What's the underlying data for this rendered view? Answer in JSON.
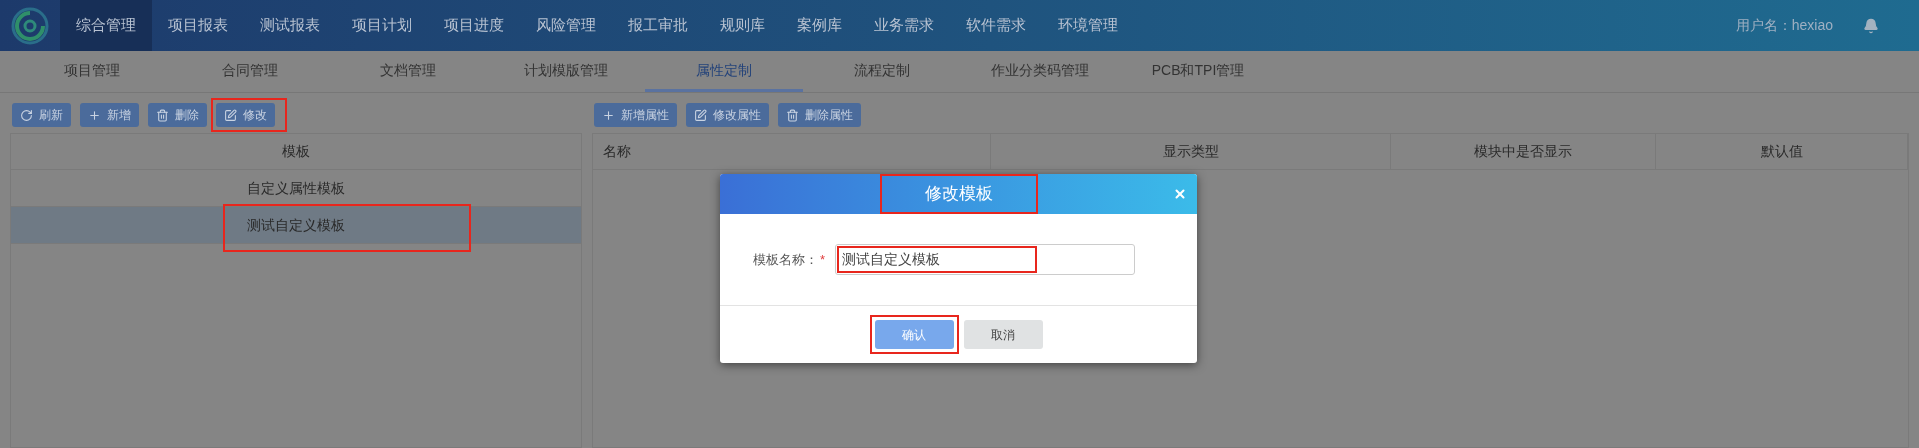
{
  "nav": {
    "items": [
      {
        "label": "综合管理",
        "selected": true
      },
      {
        "label": "项目报表",
        "selected": false
      },
      {
        "label": "测试报表",
        "selected": false
      },
      {
        "label": "项目计划",
        "selected": false
      },
      {
        "label": "项目进度",
        "selected": false
      },
      {
        "label": "风险管理",
        "selected": false
      },
      {
        "label": "报工审批",
        "selected": false
      },
      {
        "label": "规则库",
        "selected": false
      },
      {
        "label": "案例库",
        "selected": false
      },
      {
        "label": "业务需求",
        "selected": false
      },
      {
        "label": "软件需求",
        "selected": false
      },
      {
        "label": "环境管理",
        "selected": false
      }
    ],
    "user": "用户名：hexiao"
  },
  "subnav": [
    {
      "label": "项目管理",
      "selected": false
    },
    {
      "label": "合同管理",
      "selected": false
    },
    {
      "label": "文档管理",
      "selected": false
    },
    {
      "label": "计划模版管理",
      "selected": false
    },
    {
      "label": "属性定制",
      "selected": true
    },
    {
      "label": "流程定制",
      "selected": false
    },
    {
      "label": "作业分类码管理",
      "selected": false
    },
    {
      "label": "PCB和TPI管理",
      "selected": false
    }
  ],
  "left_toolbar": [
    {
      "kind": "refresh",
      "label": "刷新",
      "highlighted": false
    },
    {
      "kind": "add",
      "label": "新增",
      "highlighted": false
    },
    {
      "kind": "delete",
      "label": "删除",
      "highlighted": false
    },
    {
      "kind": "edit",
      "label": "修改",
      "highlighted": true
    }
  ],
  "template_table": {
    "column": "模板",
    "rows": [
      {
        "name": "自定义属性模板",
        "selected": false,
        "highlighted": false
      },
      {
        "name": "测试自定义模板",
        "selected": true,
        "highlighted": true
      }
    ]
  },
  "right_toolbar": [
    {
      "kind": "add",
      "label": "新增属性",
      "highlighted": false
    },
    {
      "kind": "edit",
      "label": "修改属性",
      "highlighted": false
    },
    {
      "kind": "delete",
      "label": "删除属性",
      "highlighted": false
    }
  ],
  "attribute_table": {
    "columns": [
      "名称",
      "显示类型",
      "模块中是否显示",
      "默认值"
    ]
  },
  "dialog": {
    "title": "修改模板",
    "title_highlighted": true,
    "field_label": "模板名称：",
    "required_mark": "*",
    "value": "测试自定义模板",
    "value_highlighted": true,
    "buttons": [
      {
        "kind": "primary",
        "label": "确认",
        "highlighted": true
      },
      {
        "kind": "secondary",
        "label": "取消",
        "highlighted": false
      }
    ]
  }
}
